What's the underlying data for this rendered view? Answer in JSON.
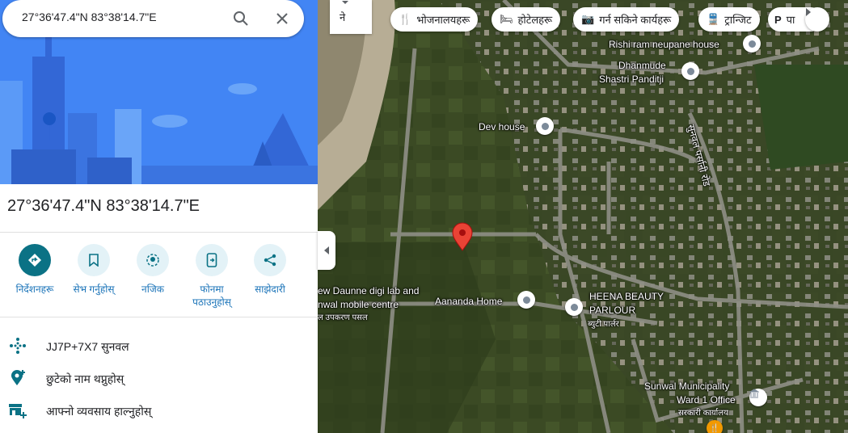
{
  "search": {
    "value": "27°36'47.4\"N 83°38'14.7\"E"
  },
  "place": {
    "title": "27°36'47.4\"N 83°38'14.7\"E"
  },
  "actions": [
    {
      "label": "निर्देशनहरू",
      "icon": "directions-icon"
    },
    {
      "label": "सेभ गर्नुहोस्",
      "icon": "bookmark-icon"
    },
    {
      "label": "नजिक",
      "icon": "nearby-icon"
    },
    {
      "label": "फोनमा पठाउनुहोस्",
      "icon": "send-to-phone-icon"
    },
    {
      "label": "साझेदारी",
      "icon": "share-icon"
    }
  ],
  "info": [
    {
      "text": "JJ7P+7X7 सुनवल",
      "icon": "plus-code-icon"
    },
    {
      "text": "छुटेको नाम थप्नुहोस्",
      "icon": "add-place-icon"
    },
    {
      "text": "आफ्नो व्यवसाय हाल्नुहोस्",
      "icon": "add-business-icon"
    }
  ],
  "map": {
    "layer_button": "ने",
    "chips": [
      {
        "label": "भोजनालयहरू",
        "icon": "restaurant-icon"
      },
      {
        "label": "होटेलहरू",
        "icon": "hotel-icon"
      },
      {
        "label": "गर्न सकिने कार्यहरू",
        "icon": "camera-icon"
      },
      {
        "label": "ट्रान्जिट",
        "icon": "transit-icon"
      },
      {
        "label": "पा",
        "icon": "parking-icon"
      }
    ],
    "labels": {
      "rishi": "Rishi ram neupane house",
      "dhanmude1": "Dhanmude",
      "dhanmude2": "Shastri Panditji",
      "dev": "Dev house",
      "road": "सुनवल पर्सानी रोड",
      "daunne1": "ew Daunne digi lab and",
      "daunne2": "nwal mobile centre",
      "daunne3": "ल उपकरण पसल",
      "aananda": "Aananda Home",
      "heena1": "HEENA BEAUTY",
      "heena2": "PARLOUR",
      "heena3": "ब्युटी पार्लर",
      "sunwal1": "Sunwal Municipality",
      "sunwal2": "Ward 1 Office",
      "sunwal3": "सरकारी कार्यालय"
    },
    "colors": {
      "pin": "#ea4335",
      "accent": "#1a73b8",
      "directions": "#0b7285"
    }
  }
}
